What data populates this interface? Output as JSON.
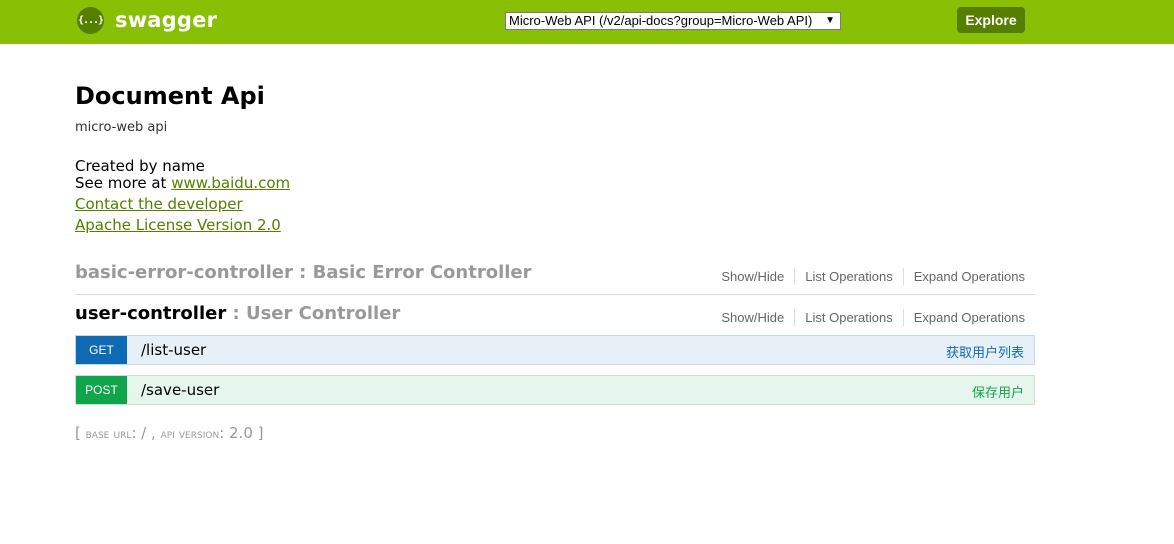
{
  "header": {
    "logo_icon_text": "{...}",
    "logo_text": "swagger",
    "api_select_value": "Micro-Web API (/v2/api-docs?group=Micro-Web API)",
    "explore_label": "Explore",
    "colors": {
      "bar": "#89bf04",
      "dark": "#547f00"
    }
  },
  "info": {
    "title": "Document Api",
    "description": "micro-web api",
    "created_by": "Created by name",
    "see_more_prefix": "See more at ",
    "see_more_link": "www.baidu.com",
    "contact_link": "Contact the developer",
    "license_link": "Apache License Version 2.0"
  },
  "resources": [
    {
      "name": "basic-error-controller",
      "description": ": Basic Error Controller",
      "ops": [
        "Show/Hide",
        "List Operations",
        "Expand Operations"
      ]
    },
    {
      "name": "user-controller",
      "description": ": User Controller",
      "ops": [
        "Show/Hide",
        "List Operations",
        "Expand Operations"
      ]
    }
  ],
  "operations": [
    {
      "method": "GET",
      "path": "/list-user",
      "summary": "获取用户列表",
      "color": "#0f6ab4"
    },
    {
      "method": "POST",
      "path": "/save-user",
      "summary": "保存用户",
      "color": "#10a54a"
    }
  ],
  "footer": {
    "open": "[ ",
    "base_url_label": "base url",
    "base_url_value": ": / , ",
    "api_version_label": "api version",
    "api_version_value": ": 2.0 ]"
  }
}
